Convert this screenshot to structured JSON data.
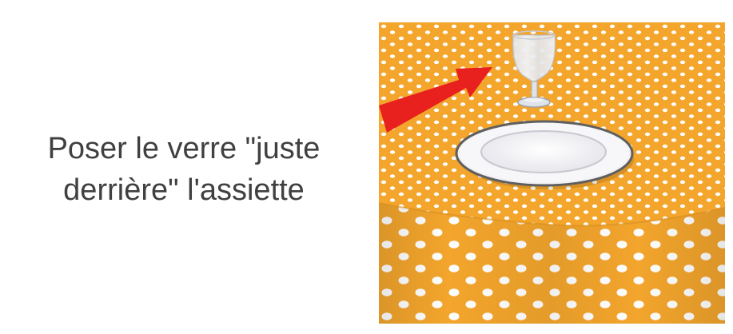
{
  "caption": {
    "line1": "Poser le verre \"juste",
    "line2": "derrière\" l'assiette"
  },
  "illustration": {
    "tablecloth_color": "#f3a52c",
    "dot_color": "#ffffff",
    "arrow_color": "#e8211f",
    "plate_rim_color": "#5f5f5f",
    "plate_color": "#f2f2f6",
    "glass_color": "#dfe3ea"
  }
}
